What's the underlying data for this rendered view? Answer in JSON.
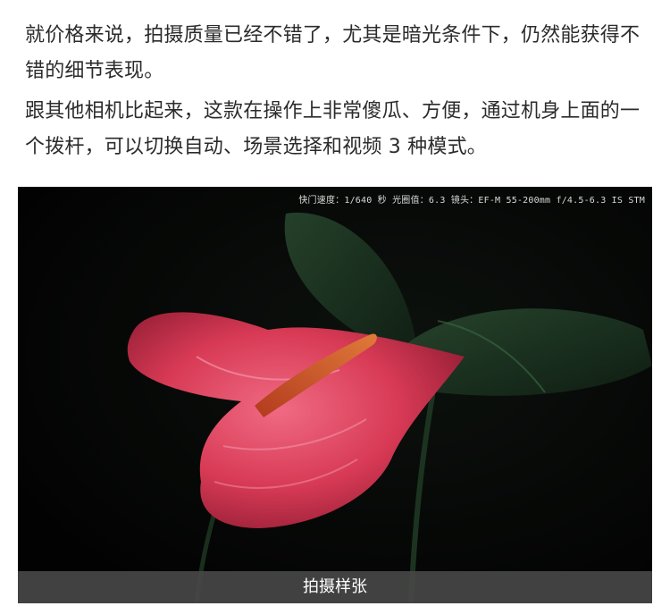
{
  "article": {
    "paragraph_1": "就价格来说，拍摄质量已经不错了，尤其是暗光条件下，仍然能获得不错的细节表现。",
    "paragraph_2": "跟其他相机比起来，这款在操作上非常傻瓜、方便，通过机身上面的一个拨杆，可以切换自动、场景选择和视频 3 种模式。"
  },
  "photo": {
    "exif_text": "快门速度：1/640 秒   光圈值：6.3   镜头：EF-M 55-200mm f/4.5-6.3 IS STM",
    "caption": "拍摄样张",
    "colors": {
      "background": "#030303",
      "spathe": "#d83a55",
      "spadix": "#c9542d",
      "leaf": "#1f3a25"
    }
  }
}
